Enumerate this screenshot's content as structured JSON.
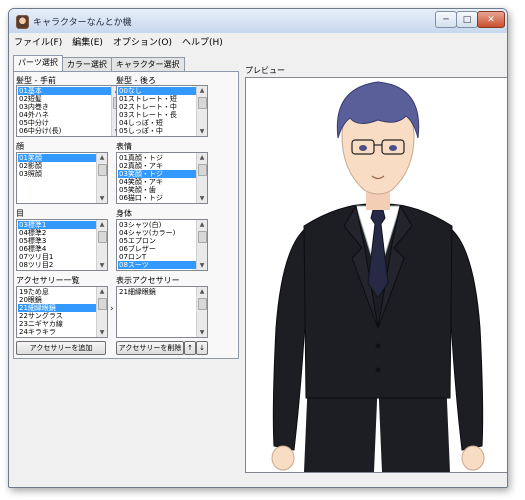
{
  "window": {
    "title": "キャラクターなんとか機",
    "minimize": "─",
    "maximize": "□",
    "close": "✕"
  },
  "menu": [
    "ファイル(F)",
    "編集(E)",
    "オプション(O)",
    "ヘルプ(H)"
  ],
  "tabs": [
    {
      "label": "パーツ選択",
      "active": true
    },
    {
      "label": "カラー選択",
      "active": false
    },
    {
      "label": "キャラクター選択",
      "active": false
    }
  ],
  "lists": {
    "hair_front": {
      "label": "髪型 - 手前",
      "items": [
        "01基本",
        "02短髪",
        "03内巻き",
        "04外ハネ",
        "05中分け",
        "06中分け(長)"
      ],
      "selected": 0
    },
    "hair_back": {
      "label": "髪型 - 後ろ",
      "items": [
        "00なし",
        "01ストレート・短",
        "02ストレート・中",
        "03ストレート・長",
        "04しっぽ・短",
        "05しっぽ・中"
      ],
      "selected": 0
    },
    "face": {
      "label": "顔",
      "items": [
        "01笑顔",
        "02影顔",
        "03照顔"
      ],
      "selected": 0
    },
    "expression": {
      "label": "表情",
      "items": [
        "01真顔・トジ",
        "02真顔・アキ",
        "03笑顔・トジ",
        "04笑顔・アキ",
        "05笑顔・歯",
        "06猫口・トジ"
      ],
      "selected": 2
    },
    "eyes": {
      "label": "目",
      "items": [
        "03標準1",
        "04標準2",
        "05標準3",
        "06標準4",
        "07ツリ目1",
        "08ツリ目2"
      ],
      "selected": 0
    },
    "body": {
      "label": "身体",
      "items": [
        "03シャツ(白)",
        "04シャツ(カラー)",
        "05エプロン",
        "06ブレザー",
        "07ロンT",
        "08スーツ"
      ],
      "selected": 5
    },
    "accessory_all": {
      "label": "アクセサリー一覧",
      "items": [
        "19ため息",
        "20眼鏡",
        "21細縁眼鏡",
        "22サングラス",
        "23ニギヤカ線",
        "24キラキラ"
      ],
      "selected": 2
    },
    "accessory_shown": {
      "label": "表示アクセサリー",
      "items": [
        "21細縁眼鏡"
      ],
      "selected": -1
    }
  },
  "buttons": {
    "add_accessory": "アクセサリーを追加",
    "remove_accessory": "アクセサリーを削除",
    "move_up": "↑",
    "move_down": "↓",
    "transfer": "›"
  },
  "preview": {
    "label": "プレビュー"
  },
  "colors": {
    "hair": "#5a5f9a",
    "suit": "#1d1d24",
    "tie": "#262a44",
    "skin": "#f9dcc4",
    "selection": "#3399ff"
  }
}
